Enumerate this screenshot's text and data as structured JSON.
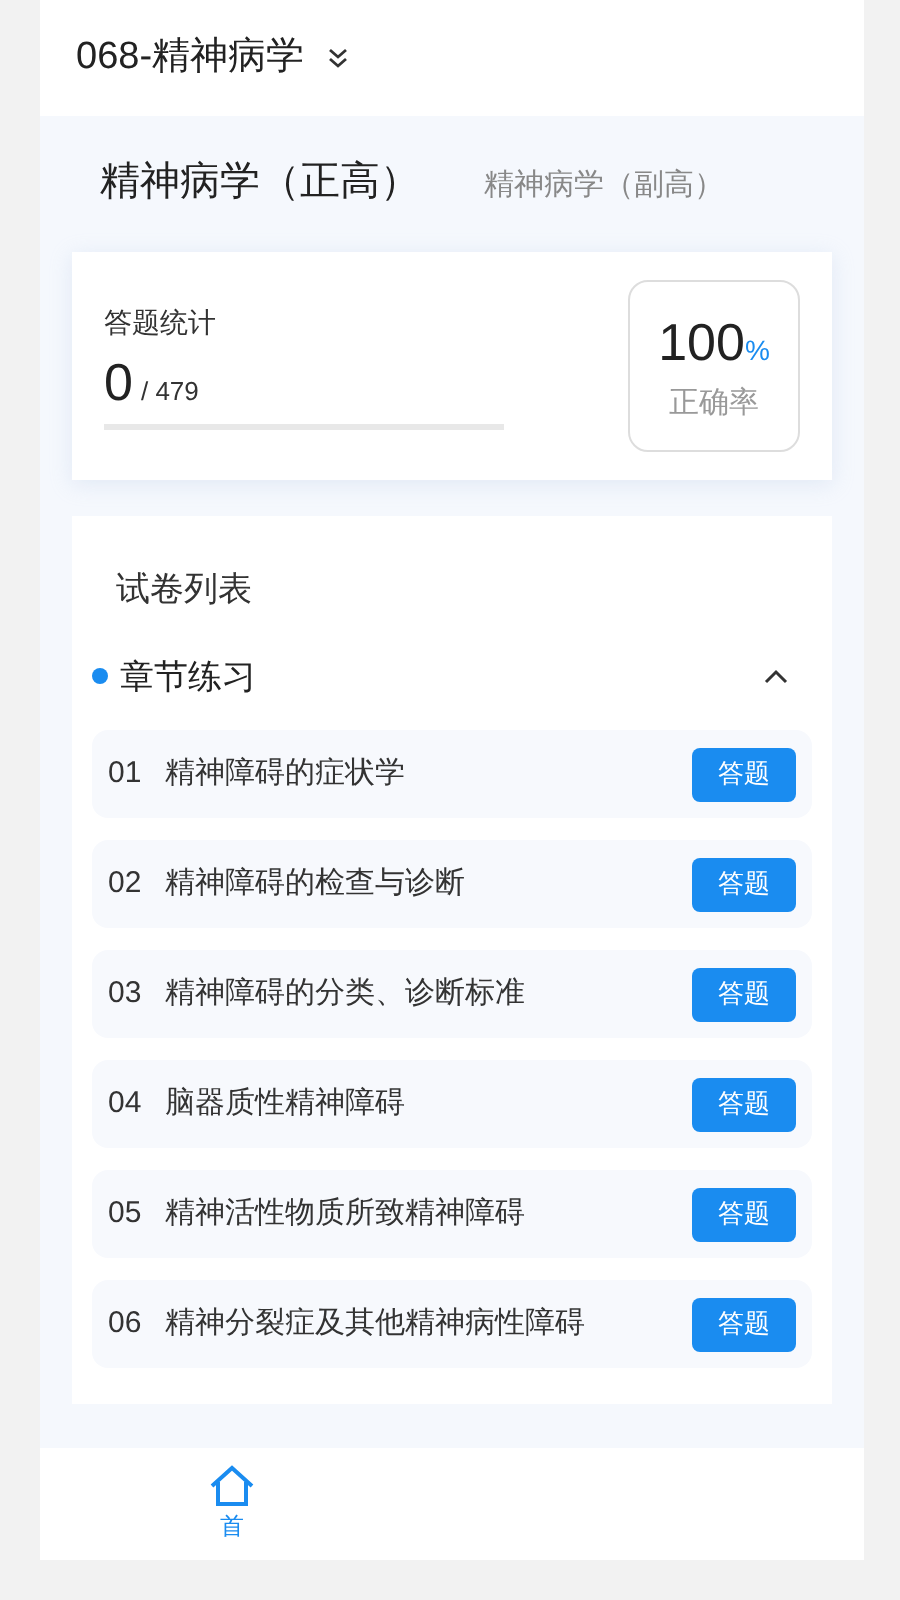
{
  "header": {
    "title": "068-精神病学"
  },
  "tabs": [
    {
      "label": "精神病学（正高）",
      "selected": true
    },
    {
      "label": "精神病学（副高）",
      "selected": false
    }
  ],
  "stats": {
    "title": "答题统计",
    "done": "0",
    "total": "/ 479",
    "level": 0,
    "accuracy": "100",
    "unit": "%",
    "accuracy_label": "正确率"
  },
  "list": {
    "title": "试卷列表",
    "section": {
      "title": "章节练习",
      "expanded": true,
      "items": [
        {
          "num": "01",
          "name": "精神障碍的症状学",
          "action": "答题"
        },
        {
          "num": "02",
          "name": "精神障碍的检查与诊断",
          "action": "答题"
        },
        {
          "num": "03",
          "name": "精神障碍的分类、诊断标准",
          "action": "答题"
        },
        {
          "num": "04",
          "name": "脑器质性精神障碍",
          "action": "答题"
        },
        {
          "num": "05",
          "name": "精神活性物质所致精神障碍",
          "action": "答题"
        },
        {
          "num": "06",
          "name": "精神分裂症及其他精神病性障碍",
          "action": "答题"
        }
      ]
    }
  },
  "bottom_nav": [
    {
      "label": "首",
      "selected": true
    }
  ]
}
